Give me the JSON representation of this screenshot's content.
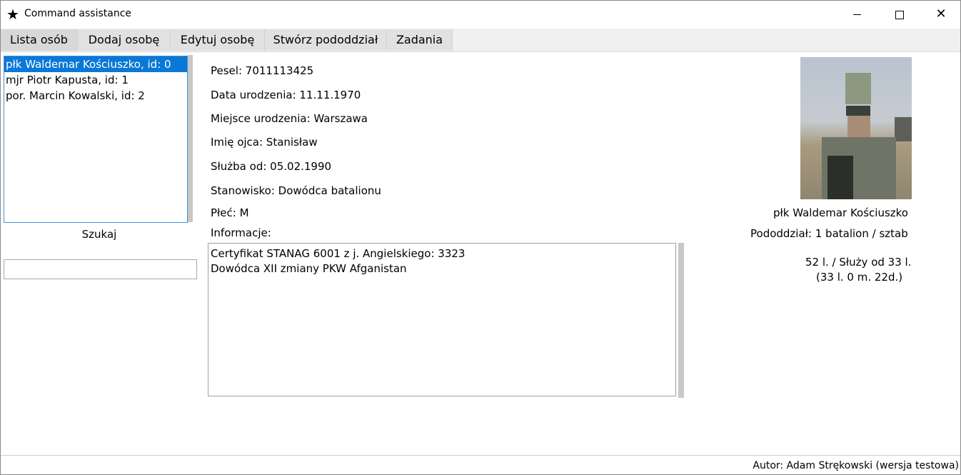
{
  "window": {
    "title": "Command assistance",
    "icon": "star-icon",
    "controls": {
      "minimize": "minimize-icon",
      "maximize": "maximize-icon",
      "close": "✕"
    }
  },
  "tabs": [
    "Lista osób",
    "Dodaj osobę",
    "Edytuj osobę",
    "Stwórz pododdział",
    "Zadania"
  ],
  "people": [
    "płk Waldemar Kościuszko, id: 0",
    "mjr Piotr Kapusta, id: 1",
    "por. Marcin Kowalski, id: 2"
  ],
  "search": {
    "label": "Szukaj",
    "value": ""
  },
  "details": {
    "pesel": "Pesel: 7011113425",
    "birth_date": "Data urodzenia: 11.11.1970",
    "birth_place": "Miejsce urodzenia: Warszawa",
    "father": "Imię ojca: Stanisław",
    "service_since": "Służba od: 05.02.1990",
    "position": "Stanowisko:  Dowódca batalionu",
    "sex": "Płeć: M",
    "info_label": "Informacje:",
    "info_lines": [
      "Certyfikat STANAG 6001 z j. Angielskiego: 3323",
      "Dowódca XII zmiany PKW Afganistan"
    ]
  },
  "profile": {
    "name": "płk Waldemar Kościuszko",
    "unit": "Pododdział: 1 batalion / sztab",
    "age_service": "52 l. / Służy od 33 l.",
    "service_detail": "(33 l. 0 m. 22d.)"
  },
  "status_bar": "Autor: Adam Strękowski (wersja testowa)"
}
